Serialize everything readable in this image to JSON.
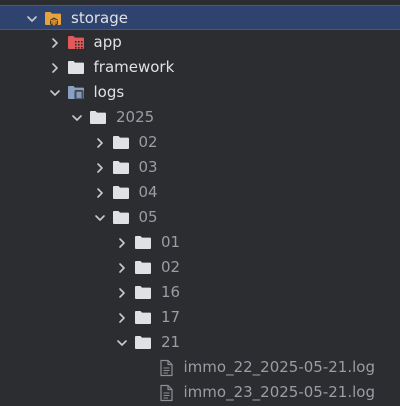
{
  "colors": {
    "folder": "#dfe1e5",
    "file": "#8c8f94",
    "storage_folder": "#e6a23c",
    "storage_badge": "#b8742a",
    "app_folder": "#e0595b",
    "logs_folder": "#8aa0c3",
    "chevron": "#c8cad0"
  },
  "items": [
    {
      "label": "storage",
      "depth": 0,
      "state": "expanded",
      "kind": "folder",
      "icon": "storage-folder-icon",
      "selected": true,
      "muted": false
    },
    {
      "label": "app",
      "depth": 1,
      "state": "collapsed",
      "kind": "folder",
      "icon": "app-folder-icon",
      "selected": false,
      "muted": false
    },
    {
      "label": "framework",
      "depth": 1,
      "state": "collapsed",
      "kind": "folder",
      "icon": "folder-icon",
      "selected": false,
      "muted": false
    },
    {
      "label": "logs",
      "depth": 1,
      "state": "expanded",
      "kind": "folder",
      "icon": "logs-folder-icon",
      "selected": false,
      "muted": false
    },
    {
      "label": "2025",
      "depth": 2,
      "state": "expanded",
      "kind": "folder",
      "icon": "folder-icon",
      "selected": false,
      "muted": true
    },
    {
      "label": "02",
      "depth": 3,
      "state": "collapsed",
      "kind": "folder",
      "icon": "folder-icon",
      "selected": false,
      "muted": true
    },
    {
      "label": "03",
      "depth": 3,
      "state": "collapsed",
      "kind": "folder",
      "icon": "folder-icon",
      "selected": false,
      "muted": true
    },
    {
      "label": "04",
      "depth": 3,
      "state": "collapsed",
      "kind": "folder",
      "icon": "folder-icon",
      "selected": false,
      "muted": true
    },
    {
      "label": "05",
      "depth": 3,
      "state": "expanded",
      "kind": "folder",
      "icon": "folder-icon",
      "selected": false,
      "muted": true
    },
    {
      "label": "01",
      "depth": 4,
      "state": "collapsed",
      "kind": "folder",
      "icon": "folder-icon",
      "selected": false,
      "muted": true
    },
    {
      "label": "02",
      "depth": 4,
      "state": "collapsed",
      "kind": "folder",
      "icon": "folder-icon",
      "selected": false,
      "muted": true
    },
    {
      "label": "16",
      "depth": 4,
      "state": "collapsed",
      "kind": "folder",
      "icon": "folder-icon",
      "selected": false,
      "muted": true
    },
    {
      "label": "17",
      "depth": 4,
      "state": "collapsed",
      "kind": "folder",
      "icon": "folder-icon",
      "selected": false,
      "muted": true
    },
    {
      "label": "21",
      "depth": 4,
      "state": "expanded",
      "kind": "folder",
      "icon": "folder-icon",
      "selected": false,
      "muted": true
    },
    {
      "label": "immo_22_2025-05-21.log",
      "depth": 5,
      "state": "leaf",
      "kind": "file",
      "icon": "log-file-icon",
      "selected": false,
      "muted": true
    },
    {
      "label": "immo_23_2025-05-21.log",
      "depth": 5,
      "state": "leaf",
      "kind": "file",
      "icon": "log-file-icon",
      "selected": false,
      "muted": true
    }
  ]
}
